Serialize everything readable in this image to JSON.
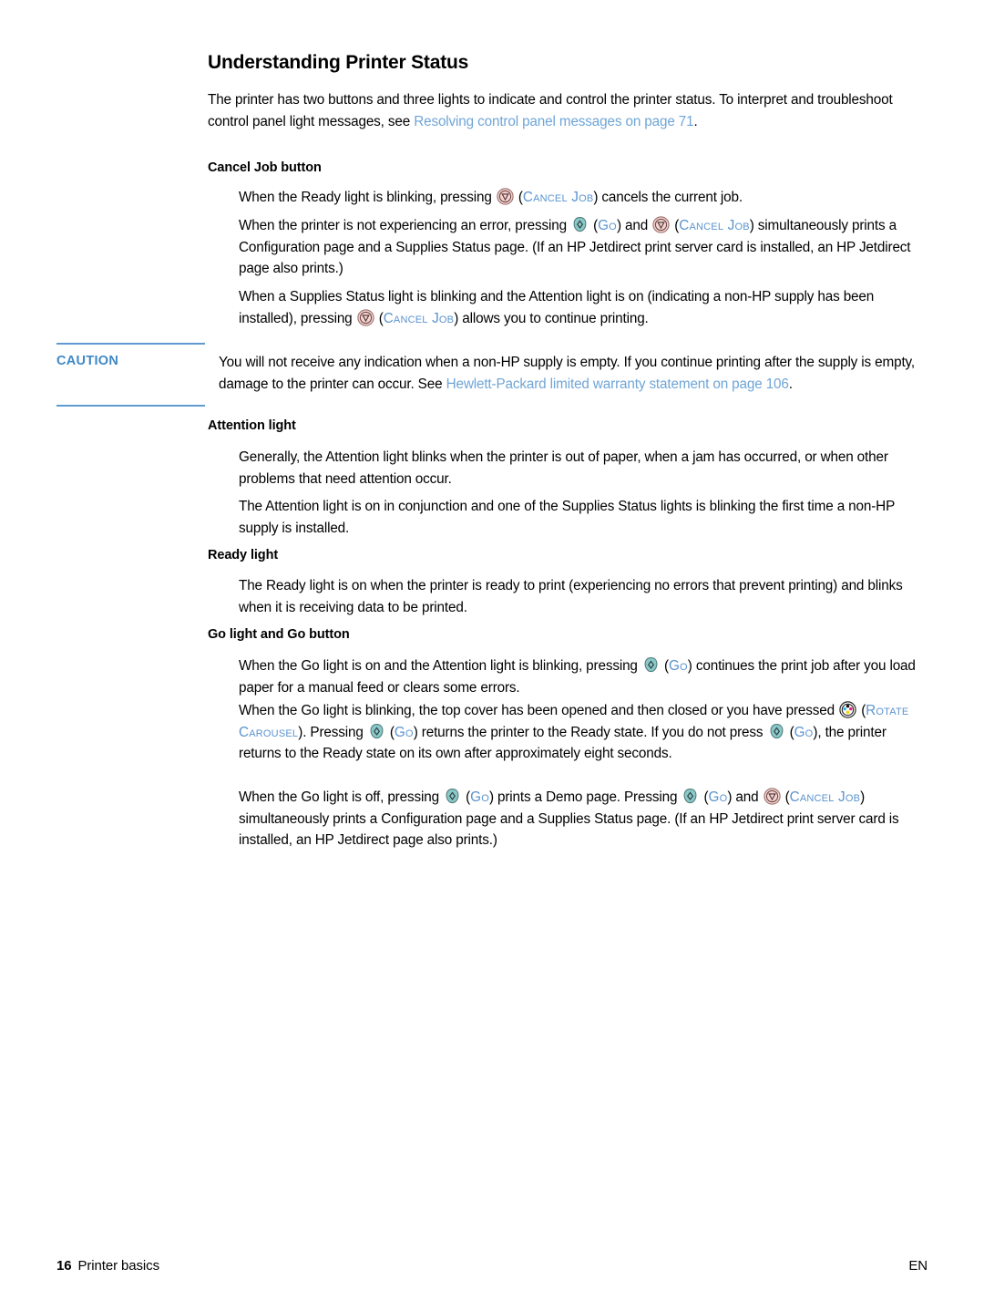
{
  "document": {
    "title": "Understanding Printer Status",
    "intro": {
      "part1": "The printer has two buttons and three lights to indicate and control the printer status. To interpret and troubleshoot control panel light messages, see ",
      "link": "Resolving control panel messages  on page 71",
      "part2": "."
    },
    "sections": [
      {
        "heading": "Cancel Job button",
        "paragraphs": [
          {
            "p1": "When the Ready light is blinking, pressing ",
            "icon1": "cancel-job-icon",
            "label1": "Cancel Job",
            "p2": " cancels the current job."
          },
          {
            "p1": "When the printer is not experiencing an error, pressing ",
            "icon1": "go-icon",
            "label1": "Go",
            "p2": " and ",
            "icon2": "cancel-job-icon",
            "label2": "Cancel Job",
            "p3": " simultaneously prints a Configuration page and a Supplies Status page. (If an HP Jetdirect print server card is installed, an HP Jetdirect page also prints.)"
          },
          {
            "p1": "When a Supplies Status light is blinking and the Attention light is on (indicating a non-HP supply has been installed), pressing ",
            "icon1": "cancel-job-icon",
            "label1": "Cancel Job",
            "p2": " allows you to continue printing."
          }
        ]
      },
      {
        "heading": "Attention light",
        "paragraphs": [
          {
            "p1": "Generally, the Attention light blinks when the printer is out of paper, when a jam has occurred, or when other problems that need attention occur."
          },
          {
            "p1": "The Attention light is on in conjunction and one of the Supplies Status lights is blinking the first time a non-HP supply is installed."
          }
        ]
      },
      {
        "heading": "Ready light",
        "paragraphs": [
          {
            "p1": "The Ready light is on when the printer is ready to print (experiencing no errors that prevent printing) and blinks when it is receiving data to be printed."
          }
        ]
      },
      {
        "heading": "Go light and Go button",
        "paragraphs": [
          {
            "p1": "When the Go light is on and the Attention light is blinking, pressing ",
            "icon1": "go-icon",
            "label1": "Go",
            "p2": " continues the print job after you load paper for a manual feed or clears some errors."
          },
          {
            "p1": "When the Go light is blinking, the top cover has been opened and then closed or you have pressed ",
            "icon1": "rotate-carousel-icon",
            "label1": "Rotate Carousel",
            "p2": ". Pressing ",
            "icon2": "go-icon",
            "label2": "Go",
            "p3": " returns the printer to the Ready state. If you do not press ",
            "icon3": "go-icon",
            "label3": "Go",
            "p4": ", the printer returns to the Ready state on its own after approximately eight seconds."
          },
          {
            "p1": "When the Go light is off, pressing ",
            "icon1": "go-icon",
            "label1": "Go",
            "p2": " prints a Demo page. Pressing ",
            "icon2": "go-icon",
            "label2": "Go",
            "p3": " and ",
            "icon3": "cancel-job-icon",
            "label3": "Cancel Job",
            "p4": " simultaneously prints a Configuration page and a Supplies Status page. (If an HP Jetdirect print server card is installed, an HP Jetdirect page also prints.)"
          }
        ]
      }
    ],
    "caution": {
      "label": "CAUTION",
      "part1": "You will not receive any indication when a non-HP supply is empty. If you continue printing after the supply is empty, damage to the printer can occur. See ",
      "link": "Hewlett-Packard limited warranty statement  on page 106",
      "part2": "."
    },
    "footer": {
      "page_number": "16",
      "section_name": "Printer basics",
      "language": "EN"
    },
    "colors": {
      "link": "#6fa5d6",
      "smallcaps": "#5b94cf",
      "caution": "#3f88c5",
      "caution_rule": "#5f9bd1",
      "cancel_job_fill": "#f7d5d2",
      "go_fill": "#8cc8c8"
    }
  }
}
